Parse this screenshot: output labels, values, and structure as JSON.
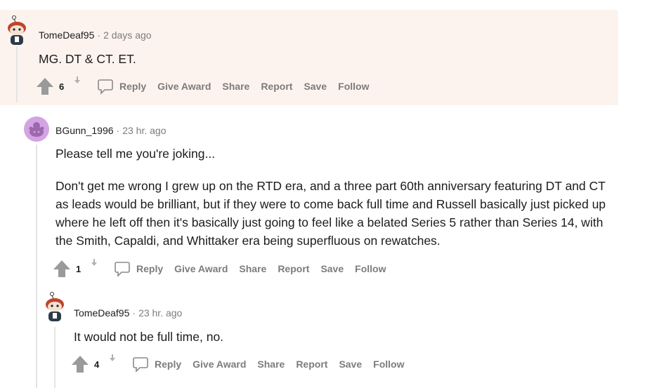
{
  "comments": [
    {
      "author": "TomeDeaf95",
      "separator": "·",
      "time": "2 days ago",
      "paragraphs": [
        "MG. DT & CT. ET."
      ],
      "score": "6"
    },
    {
      "author": "BGunn_1996",
      "separator": "·",
      "time": "23 hr. ago",
      "paragraphs": [
        "Please tell me you're joking...",
        "Don't get me wrong I grew up on the RTD era, and a three part 60th anniversary featuring DT and CT as leads would be brilliant, but if they were to come back full time and Russell basically just picked up where he left off then it's basically just going to feel like a belated Series 5 rather than Series 14, with the Smith, Capaldi, and Whittaker era being superfluous on rewatches."
      ],
      "score": "1"
    },
    {
      "author": "TomeDeaf95",
      "separator": "·",
      "time": "23 hr. ago",
      "paragraphs": [
        "It would not be full time, no."
      ],
      "score": "4"
    }
  ],
  "actions": {
    "reply": "Reply",
    "give_award": "Give Award",
    "share": "Share",
    "report": "Report",
    "save": "Save",
    "follow": "Follow"
  },
  "colors": {
    "highlight": "#fdf3ee",
    "muted": "#7c7c7c",
    "thread_line": "#e4e4e4",
    "upvote_gray": "#9a9a9a"
  }
}
